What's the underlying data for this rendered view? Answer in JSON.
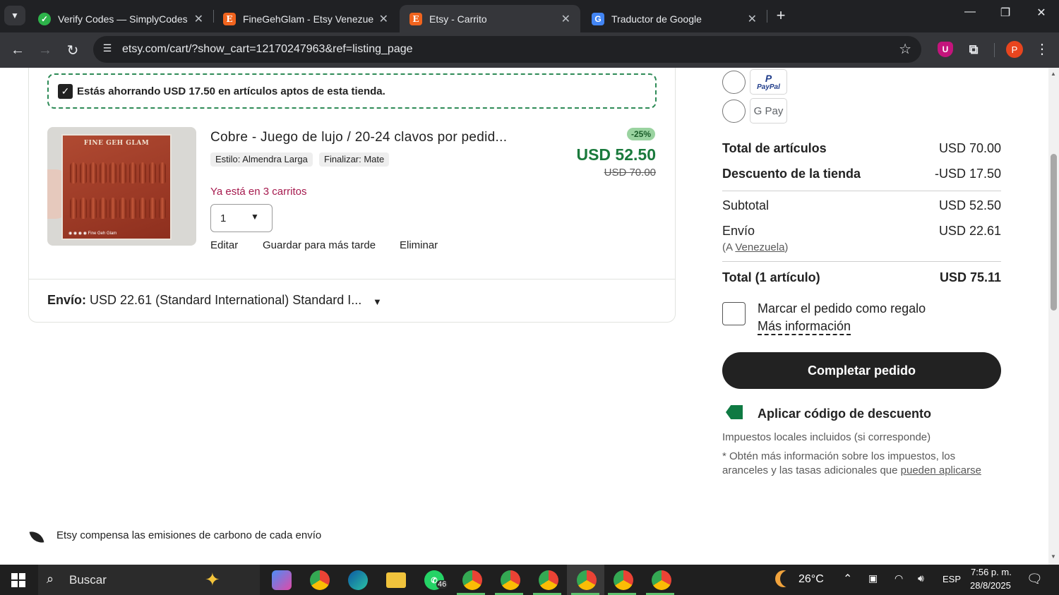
{
  "browser": {
    "tabs": [
      {
        "title": "Verify Codes — SimplyCodes",
        "favicon": "simplycodes-icon",
        "active": false
      },
      {
        "title": "FineGehGlam - Etsy Venezuela",
        "favicon": "etsy-icon",
        "active": false
      },
      {
        "title": "Etsy - Carrito",
        "favicon": "etsy-icon",
        "active": true
      },
      {
        "title": "Traductor de Google",
        "favicon": "google-translate-icon",
        "active": false
      }
    ],
    "url": "etsy.com/cart/?show_cart=12170247963&ref=listing_page",
    "profile_initial": "P"
  },
  "cart": {
    "savings_notice": "Estás ahorrando USD 17.50 en artículos aptos de esta tienda.",
    "item": {
      "image_brand": "Fine Geh Glam",
      "title": "Cobre - Juego de lujo / 20-24 clavos por pedid...",
      "variants": [
        "Estilo: Almendra Larga",
        "Finalizar: Mate"
      ],
      "discount_badge": "-25%",
      "price": "USD 52.50",
      "original_price": "USD 70.00",
      "carts_notice": "Ya está en 3 carritos",
      "quantity": "1",
      "actions": [
        "Editar",
        "Guardar para más tarde",
        "Eliminar"
      ]
    },
    "shipping": {
      "label": "Envío:",
      "value": "USD 22.61 (Standard International) Standard I..."
    },
    "carbon_notice": "Etsy compensa las emisiones de carbono de cada envío"
  },
  "summary": {
    "payment_methods": [
      "PayPal",
      "G Pay"
    ],
    "rows": {
      "items_total_label": "Total de artículos",
      "items_total_value": "USD 70.00",
      "shop_discount_label": "Descuento de la tienda",
      "shop_discount_value": "-USD 17.50",
      "subtotal_label": "Subtotal",
      "subtotal_value": "USD 52.50",
      "shipping_label": "Envío",
      "shipping_value": "USD 22.61",
      "destination_prefix": "(A ",
      "destination": "Venezuela",
      "destination_suffix": ")",
      "total_label": "Total (1 artículo)",
      "total_value": "USD 75.11"
    },
    "gift_label": "Marcar el pedido como regalo",
    "gift_more": "Más información",
    "checkout_button": "Completar pedido",
    "coupon_label": "Aplicar código de descuento",
    "tax_note_1": "Impuestos locales incluidos (si corresponde)",
    "tax_note_2": "* Obtén más información sobre los impuestos, los aranceles y las tasas adicionales que ",
    "tax_note_link": "pueden aplicarse"
  },
  "taskbar": {
    "search_placeholder": "Buscar",
    "whatsapp_badge": "46",
    "weather": "26°C",
    "language": "ESP",
    "time": "7:56 p. m.",
    "date": "28/8/2025"
  },
  "colors": {
    "etsy_orange": "#f1641e",
    "price_green": "#1a7a3c",
    "carts_red": "#a61a4e",
    "savings_border": "#2e8b57"
  }
}
